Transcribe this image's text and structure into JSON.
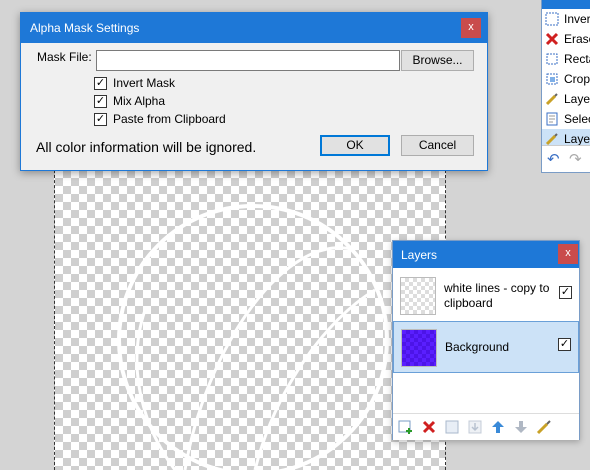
{
  "dialog": {
    "title": "Alpha Mask Settings",
    "close_label": "x",
    "mask_file_label": "Mask File:",
    "mask_file_value": "",
    "browse_label": "Browse...",
    "options": [
      {
        "label": "Invert Mask",
        "checked": true
      },
      {
        "label": "Mix Alpha",
        "checked": true
      },
      {
        "label": "Paste from Clipboard",
        "checked": true
      }
    ],
    "message": "All color information will be ignored.",
    "ok_label": "OK",
    "cancel_label": "Cancel"
  },
  "history": {
    "items": [
      {
        "label": "Invert",
        "icon": "invert-icon"
      },
      {
        "label": "Erase",
        "icon": "erase-icon"
      },
      {
        "label": "Recta",
        "icon": "rectangle-select-icon"
      },
      {
        "label": "Crop",
        "icon": "crop-icon"
      },
      {
        "label": "Layer",
        "icon": "layer-properties-icon"
      },
      {
        "label": "Select",
        "icon": "select-icon"
      },
      {
        "label": "Layer",
        "icon": "layer-properties-icon",
        "selected": true
      }
    ],
    "footer_icons": [
      "undo-icon",
      "redo-icon"
    ]
  },
  "layers": {
    "title": "Layers",
    "close_label": "x",
    "items": [
      {
        "name": "white lines - copy to clipboard",
        "visible": true,
        "thumb": "transparent"
      },
      {
        "name": "Background",
        "visible": true,
        "thumb": "purple",
        "selected": true
      }
    ],
    "toolbar_icons": [
      "add-layer-icon",
      "delete-layer-icon",
      "duplicate-layer-icon",
      "merge-down-icon",
      "move-up-icon",
      "move-down-icon",
      "layer-properties-icon"
    ]
  },
  "colors": {
    "accent": "#1e78d7",
    "close": "#c94c4c",
    "selection": "#cce2f7",
    "layer_background": "#5a1fff"
  }
}
